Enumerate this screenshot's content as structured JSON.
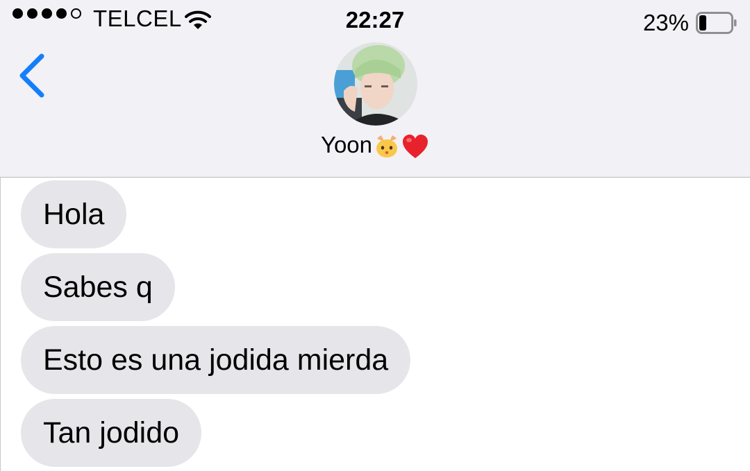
{
  "status_bar": {
    "carrier": "TELCEL",
    "signal_bars": 4,
    "signal_total": 5,
    "time": "22:27",
    "battery_percent": "23%",
    "battery_level": 0.23,
    "icons": [
      "signal-dots-icon",
      "wifi-icon",
      "battery-icon"
    ]
  },
  "nav": {
    "back_icon": "chevron-left-icon",
    "contact_name": "Yoon",
    "contact_emojis": [
      "cat-face-emoji",
      "red-heart-emoji"
    ]
  },
  "messages": [
    {
      "text": "Hola",
      "direction": "incoming"
    },
    {
      "text": "Sabes q",
      "direction": "incoming"
    },
    {
      "text": "Esto es una jodida mierda",
      "direction": "incoming"
    },
    {
      "text": "Tan jodido",
      "direction": "incoming"
    }
  ],
  "colors": {
    "accent": "#157efb",
    "incoming_bubble": "#e5e5ea",
    "header_bg": "#f2f1f6"
  }
}
